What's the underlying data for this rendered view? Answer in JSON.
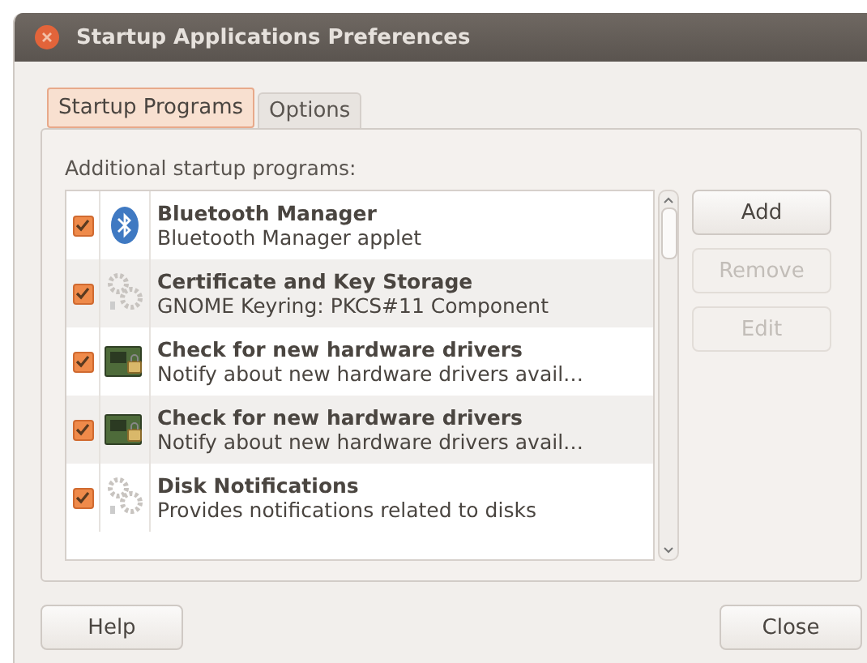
{
  "window": {
    "title": "Startup Applications Preferences"
  },
  "tabs": [
    {
      "label": "Startup Programs",
      "selected": true
    },
    {
      "label": "Options",
      "selected": false
    }
  ],
  "list_label": "Additional startup programs:",
  "programs": [
    {
      "kind": "bluetooth",
      "name": "Bluetooth Manager",
      "description": "Bluetooth Manager applet",
      "checked": true
    },
    {
      "kind": "gears",
      "name": "Certificate and Key Storage",
      "description": "GNOME Keyring: PKCS#11 Component",
      "checked": true
    },
    {
      "kind": "hardware",
      "name": "Check for new hardware drivers",
      "description": "Notify about new hardware drivers avail…",
      "checked": true
    },
    {
      "kind": "hardware",
      "name": "Check for new hardware drivers",
      "description": "Notify about new hardware drivers avail…",
      "checked": true
    },
    {
      "kind": "gears",
      "name": "Disk Notifications",
      "description": "Provides notifications related to disks",
      "checked": true
    }
  ],
  "side_buttons": [
    {
      "label": "Add",
      "disabled": false
    },
    {
      "label": "Remove",
      "disabled": true
    },
    {
      "label": "Edit",
      "disabled": true
    }
  ],
  "footer_buttons": [
    "Help",
    "Close"
  ]
}
